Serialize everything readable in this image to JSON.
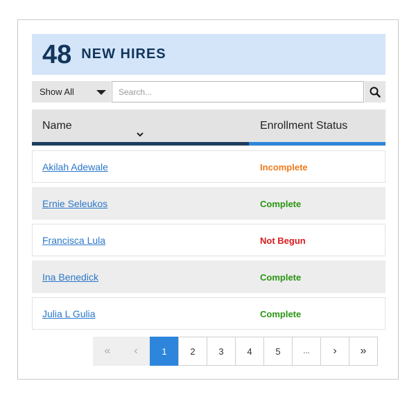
{
  "header": {
    "count": "48",
    "title": "NEW HIRES"
  },
  "filter": {
    "selected": "Show All",
    "search_placeholder": "Search..."
  },
  "table": {
    "columns": [
      "Name",
      "Enrollment Status"
    ],
    "rows": [
      {
        "name": "Akilah Adewale",
        "status": "Incomplete",
        "status_color": "#f07a1c"
      },
      {
        "name": "Ernie Seleukos",
        "status": "Complete",
        "status_color": "#2a9512"
      },
      {
        "name": "Francisca Lula",
        "status": "Not Begun",
        "status_color": "#d81c1c"
      },
      {
        "name": "Ina Benedick",
        "status": "Complete",
        "status_color": "#2a9512"
      },
      {
        "name": "Julia L Gulia",
        "status": "Complete",
        "status_color": "#2a9512"
      }
    ]
  },
  "pagination": {
    "first": "«",
    "prev": "‹",
    "pages": [
      "1",
      "2",
      "3",
      "4",
      "5"
    ],
    "current": "1",
    "ellipsis": "...",
    "next": "›",
    "last": "»"
  },
  "colors": {
    "accent": "#2d86db",
    "header_bg": "#d4e5f9",
    "navy": "#12355b"
  },
  "icons": {
    "search": "search-icon",
    "sort": "chevron-down-icon",
    "dropdown": "caret-down-icon"
  }
}
